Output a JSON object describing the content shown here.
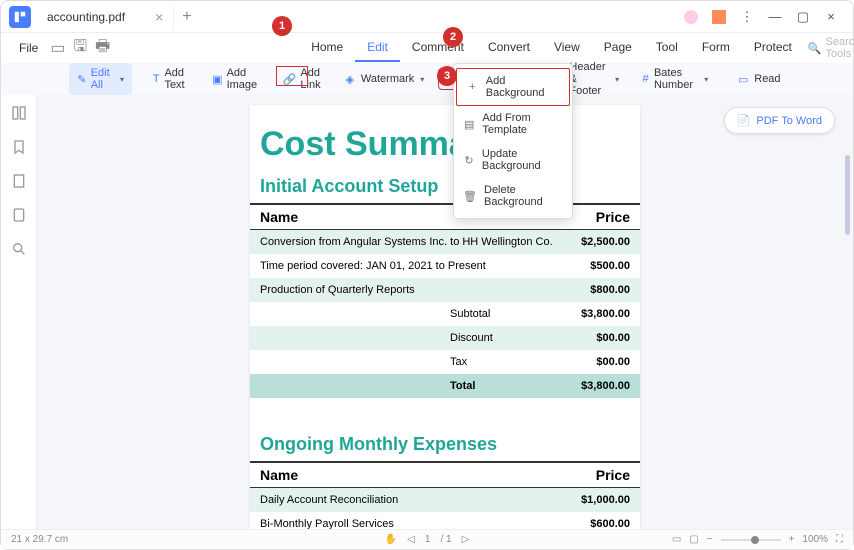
{
  "tab": {
    "filename": "accounting.pdf"
  },
  "menubar": {
    "file": "File"
  },
  "main_menu": [
    "Home",
    "Edit",
    "Comment",
    "Convert",
    "View",
    "Page",
    "Tool",
    "Form",
    "Protect"
  ],
  "search_tools": "Search Tools",
  "toolbar": {
    "edit_all": "Edit All",
    "add_text": "Add Text",
    "add_image": "Add Image",
    "add_link": "Add Link",
    "watermark": "Watermark",
    "background": "Background",
    "header_footer": "Header & Footer",
    "bates_number": "Bates Number",
    "read": "Read"
  },
  "dropdown": {
    "add_background": "Add Background",
    "add_from_template": "Add From Template",
    "update_background": "Update Background",
    "delete_background": "Delete Background"
  },
  "pdf_to_word": "PDF To Word",
  "document": {
    "title": "Cost Summa",
    "section1": {
      "heading": "Initial Account Setup",
      "col_name": "Name",
      "col_price": "Price",
      "rows": [
        {
          "name": "Conversion from Angular Systems Inc. to HH Wellington Co.",
          "price": "$2,500.00"
        },
        {
          "name": "Time period covered: JAN 01, 2021 to Present",
          "price": "$500.00"
        },
        {
          "name": "Production of Quarterly Reports",
          "price": "$800.00"
        }
      ],
      "summary": [
        {
          "label": "Subtotal",
          "price": "$3,800.00"
        },
        {
          "label": "Discount",
          "price": "$00.00"
        },
        {
          "label": "Tax",
          "price": "$00.00"
        },
        {
          "label": "Total",
          "price": "$3,800.00"
        }
      ]
    },
    "section2": {
      "heading": "Ongoing Monthly Expenses",
      "col_name": "Name",
      "col_price": "Price",
      "rows": [
        {
          "name": "Daily Account Reconciliation",
          "price": "$1,000.00"
        },
        {
          "name": "Bi-Monthly Payroll Services",
          "price": "$600.00"
        }
      ]
    }
  },
  "callouts": {
    "c1": "1",
    "c2": "2",
    "c3": "3"
  },
  "status": {
    "dims": "21 x 29.7 cm",
    "page_current": "1",
    "page_total": "/ 1",
    "zoom": "100%"
  }
}
